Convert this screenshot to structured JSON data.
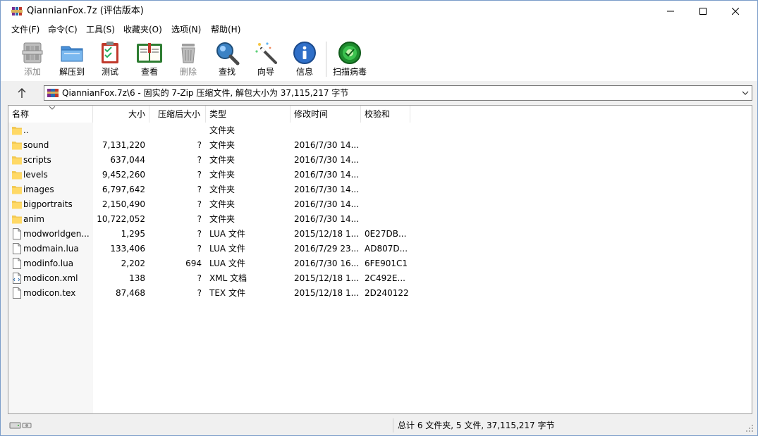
{
  "window": {
    "title": "QiannianFox.7z (评估版本)",
    "controls": {
      "minimize": "minimize-icon",
      "maximize": "maximize-icon",
      "close": "close-icon"
    }
  },
  "menu": [
    "文件(F)",
    "命令(C)",
    "工具(S)",
    "收藏夹(O)",
    "选项(N)",
    "帮助(H)"
  ],
  "toolbar": {
    "add": {
      "label": "添加",
      "icon": "archive-add-icon",
      "enabled": false
    },
    "extract": {
      "label": "解压到",
      "icon": "folder-extract-icon",
      "enabled": true
    },
    "test": {
      "label": "测试",
      "icon": "checklist-icon",
      "enabled": true
    },
    "view": {
      "label": "查看",
      "icon": "book-view-icon",
      "enabled": true
    },
    "delete": {
      "label": "删除",
      "icon": "trash-icon",
      "enabled": false
    },
    "find": {
      "label": "查找",
      "icon": "magnifier-icon",
      "enabled": true
    },
    "wizard": {
      "label": "向导",
      "icon": "wand-icon",
      "enabled": true
    },
    "info": {
      "label": "信息",
      "icon": "info-icon",
      "enabled": true
    },
    "virus": {
      "label": "扫描病毒",
      "icon": "virus-scan-icon",
      "enabled": true
    }
  },
  "path": {
    "text": "QiannianFox.7z\\6 - 固实的 7-Zip 压缩文件, 解包大小为 37,115,217 字节"
  },
  "columns": {
    "name": "名称",
    "size": "大小",
    "packed": "压缩后大小",
    "type": "类型",
    "modified": "修改时间",
    "crc": "校验和"
  },
  "files": [
    {
      "kind": "folder",
      "name": "..",
      "size": "",
      "packed": "",
      "type": "文件夹",
      "modified": "",
      "crc": ""
    },
    {
      "kind": "folder",
      "name": "sound",
      "size": "7,131,220",
      "packed": "?",
      "type": "文件夹",
      "modified": "2016/7/30 14...",
      "crc": ""
    },
    {
      "kind": "folder",
      "name": "scripts",
      "size": "637,044",
      "packed": "?",
      "type": "文件夹",
      "modified": "2016/7/30 14...",
      "crc": ""
    },
    {
      "kind": "folder",
      "name": "levels",
      "size": "9,452,260",
      "packed": "?",
      "type": "文件夹",
      "modified": "2016/7/30 14...",
      "crc": ""
    },
    {
      "kind": "folder",
      "name": "images",
      "size": "6,797,642",
      "packed": "?",
      "type": "文件夹",
      "modified": "2016/7/30 14...",
      "crc": ""
    },
    {
      "kind": "folder",
      "name": "bigportraits",
      "size": "2,150,490",
      "packed": "?",
      "type": "文件夹",
      "modified": "2016/7/30 14...",
      "crc": ""
    },
    {
      "kind": "folder",
      "name": "anim",
      "size": "10,722,052",
      "packed": "?",
      "type": "文件夹",
      "modified": "2016/7/30 14...",
      "crc": ""
    },
    {
      "kind": "file",
      "name": "modworldgen...",
      "size": "1,295",
      "packed": "?",
      "type": "LUA 文件",
      "modified": "2015/12/18 1...",
      "crc": "0E27DB..."
    },
    {
      "kind": "file",
      "name": "modmain.lua",
      "size": "133,406",
      "packed": "?",
      "type": "LUA 文件",
      "modified": "2016/7/29 23...",
      "crc": "AD807D..."
    },
    {
      "kind": "file",
      "name": "modinfo.lua",
      "size": "2,202",
      "packed": "694",
      "type": "LUA 文件",
      "modified": "2016/7/30 16...",
      "crc": "6FE901C1"
    },
    {
      "kind": "xml",
      "name": "modicon.xml",
      "size": "138",
      "packed": "?",
      "type": "XML 文档",
      "modified": "2015/12/18 1...",
      "crc": "2C492E..."
    },
    {
      "kind": "file",
      "name": "modicon.tex",
      "size": "87,468",
      "packed": "?",
      "type": "TEX 文件",
      "modified": "2015/12/18 1...",
      "crc": "2D240122"
    }
  ],
  "status": {
    "text": "总计 6 文件夹, 5 文件, 37,115,217 字节",
    "icon": "drive-icon"
  }
}
